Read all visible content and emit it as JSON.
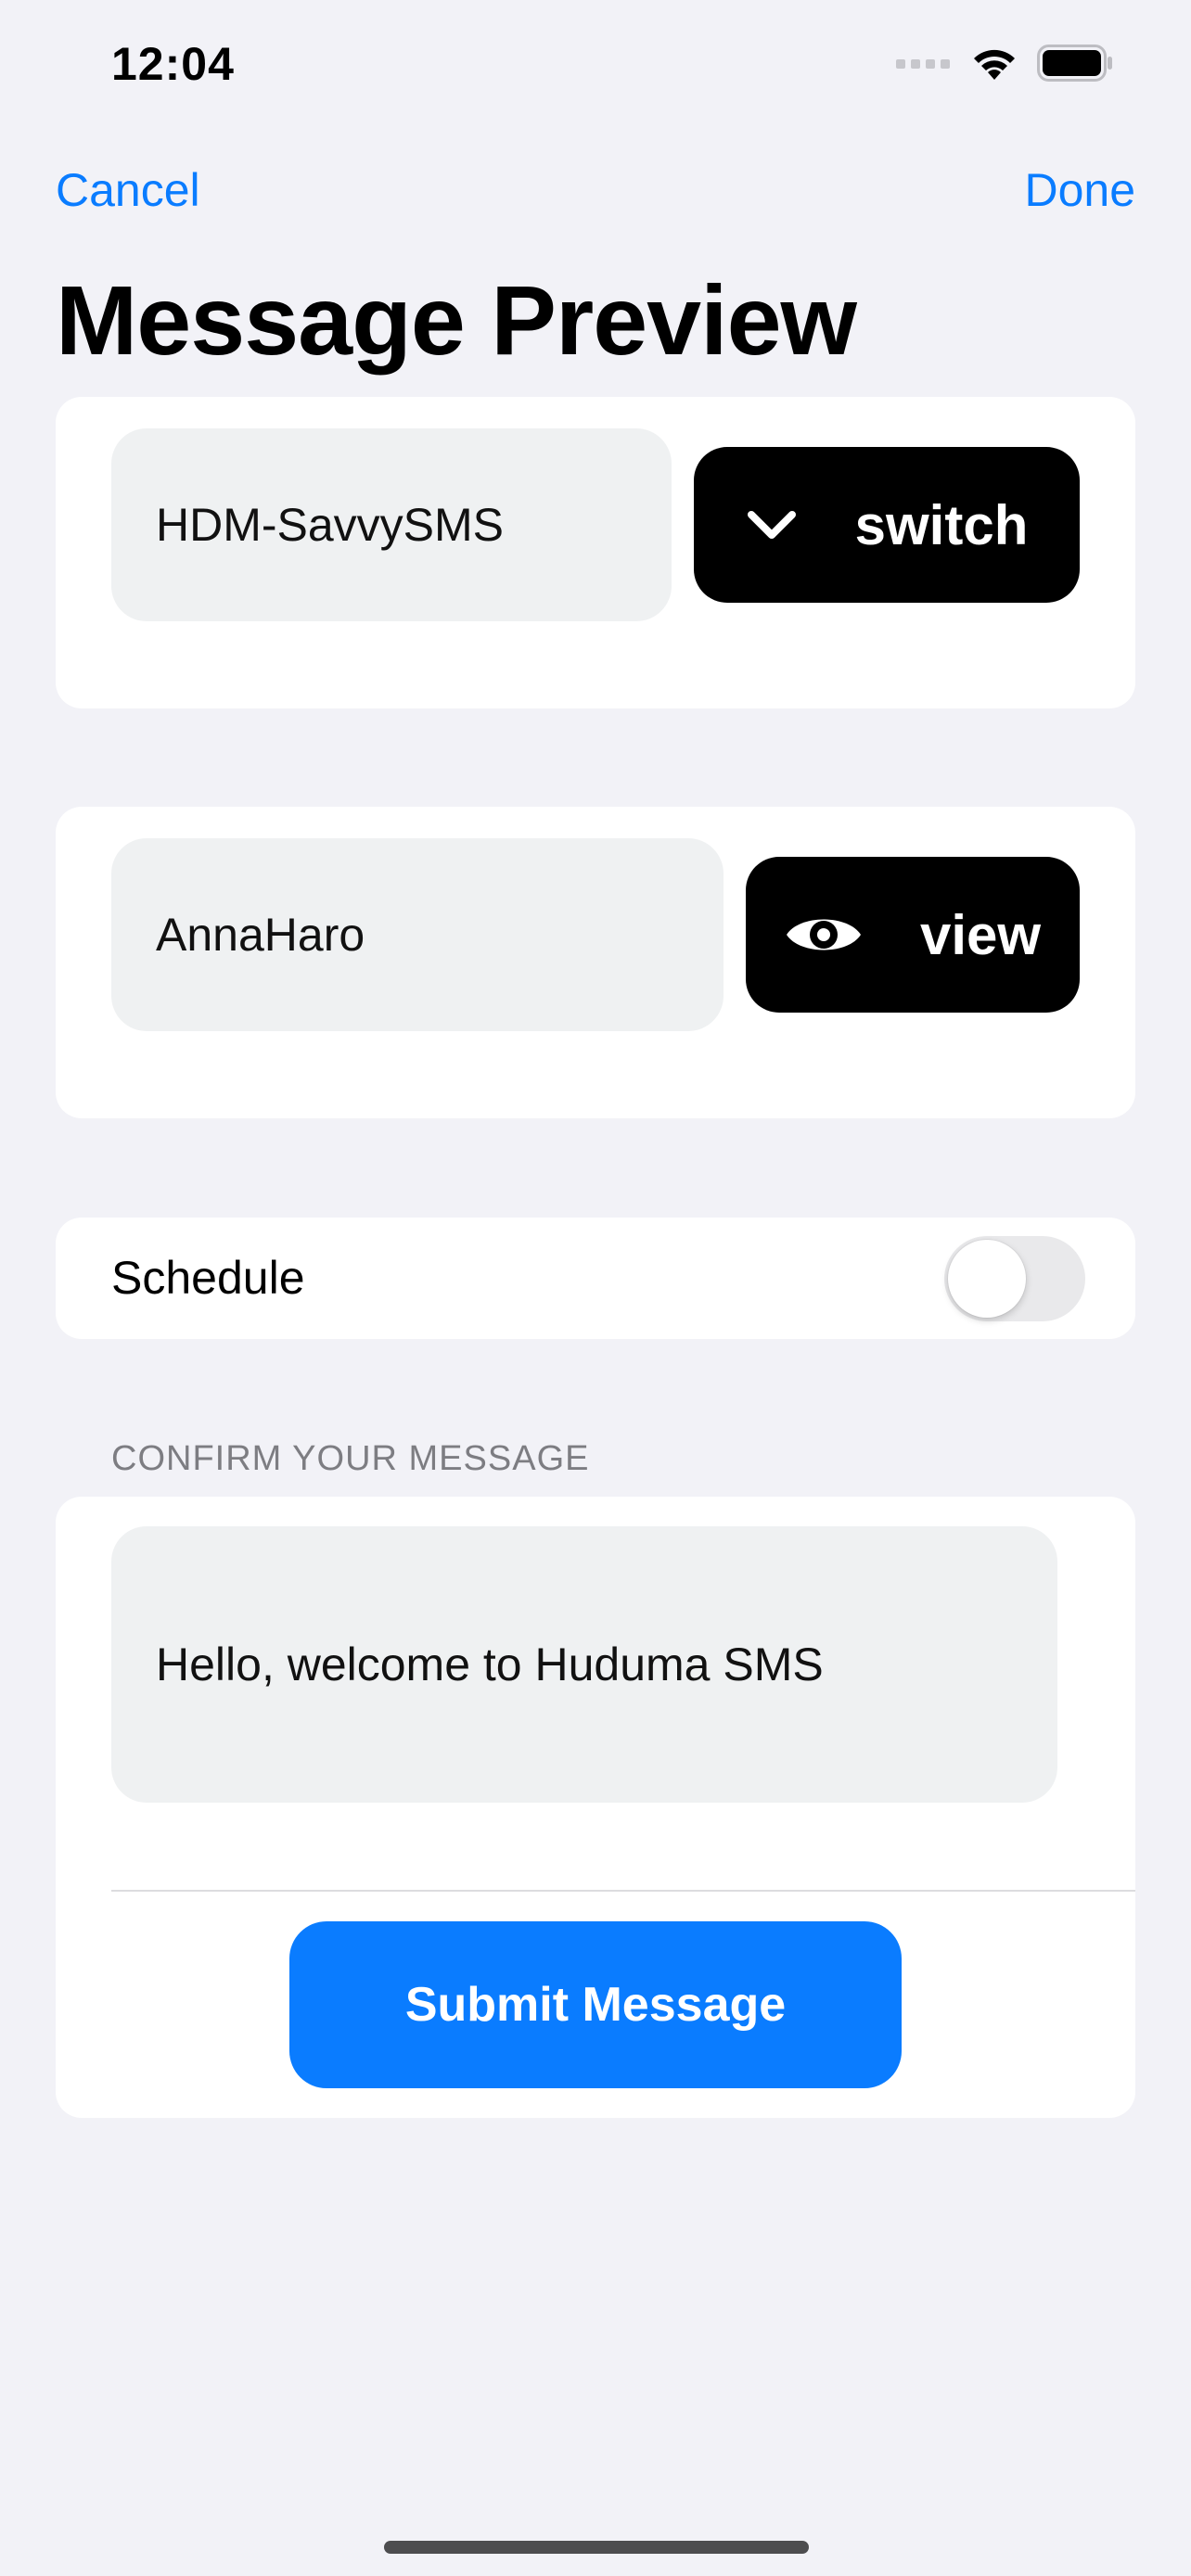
{
  "status_bar": {
    "time": "12:04"
  },
  "nav": {
    "cancel_label": "Cancel",
    "done_label": "Done"
  },
  "title": "Message Preview",
  "sender": {
    "value": "HDM-SavvySMS",
    "button_label": "switch",
    "button_icon": "chevron-down-icon"
  },
  "recipient": {
    "value": "AnnaHaro",
    "button_label": "view",
    "button_icon": "eye-icon"
  },
  "schedule": {
    "label": "Schedule",
    "enabled": false
  },
  "confirm": {
    "section_header": "CONFIRM YOUR MESSAGE",
    "message": "Hello, welcome to Huduma SMS",
    "submit_label": "Submit Message"
  },
  "colors": {
    "accent": "#0a7cff",
    "background": "#f2f2f7",
    "field": "#eff1f2"
  }
}
